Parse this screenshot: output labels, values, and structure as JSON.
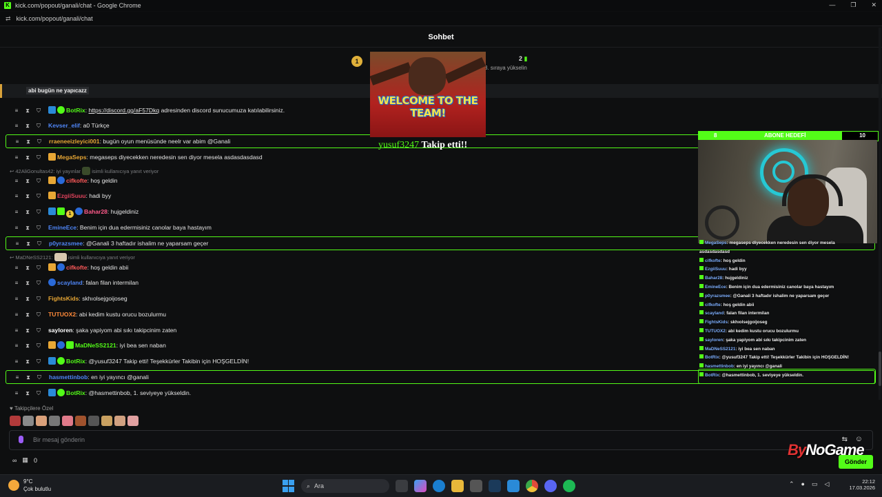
{
  "window": {
    "title": "kick.com/popout/ganali/chat - Google Chrome",
    "url": "kick.com/popout/ganali/chat",
    "min": "—",
    "restore": "❐",
    "close": "✕",
    "tune": "⇄"
  },
  "header": {
    "title": "Sohbet"
  },
  "leaderboard": {
    "rank": "1",
    "count": "2",
    "hint": "3. sıraya yükselin"
  },
  "pinned": {
    "text": "abi bugün ne yapıcazz"
  },
  "tool_icons": {
    "pin": "≡",
    "timeout": "⧗",
    "ban": "⛉"
  },
  "messages": [
    {
      "user": "BotRix",
      "color": "#53fc18",
      "sep": ": ",
      "link": "https://discord.gg/aF57Dkq",
      "text": " adresinden discord sunucumuza katılabilirsiniz."
    },
    {
      "user": "Kevser_elif",
      "color": "#4f86f7",
      "sep": ": ",
      "text": "a0 Türkçe"
    },
    {
      "user": "rraeneeizleyici001",
      "color": "#e8a735",
      "sep": ": ",
      "text": "bugün oyun menüsünde neelr var abim @Ganali"
    },
    {
      "user": "MegaSeps",
      "color": "#e8a735",
      "sep": ": ",
      "text": "megaseps diyecekken neredesin sen diyor mesela asdasdasdasd"
    },
    {
      "user": "cifkofte",
      "color": "#ff5a5a",
      "sep": ": ",
      "text": "hoş geldin"
    },
    {
      "user": "EzgiiSuuu",
      "color": "#e0435c",
      "sep": ": ",
      "text": "hadi byy"
    },
    {
      "user": "Bahar28",
      "color": "#ff5a8a",
      "sep": ": ",
      "text": "hujgeldiniz"
    },
    {
      "user": "EmineEce",
      "color": "#4f86f7",
      "sep": ": ",
      "text": "Benim için dua edermisiniz canolar baya hastayım"
    },
    {
      "user": "p0yrazsmee",
      "color": "#4f86f7",
      "sep": ": ",
      "text": "@Ganali 3 haftadır ishalim ne yaparsam geçer"
    },
    {
      "user": "cifkofte",
      "color": "#ff5a5a",
      "sep": ": ",
      "text": "hoş geldin abii"
    },
    {
      "user": "scayland",
      "color": "#4f86f7",
      "sep": ": ",
      "text": "falan filan intermilan"
    },
    {
      "user": "FightsKids",
      "color": "#e8a735",
      "sep": ": ",
      "text": "skhıolsejgoijoseg"
    },
    {
      "user": "TUTUOX2",
      "color": "#ff8a3a",
      "sep": ": ",
      "text": "abi kedim kustu orucu bozulurmu"
    },
    {
      "user": "sayloren",
      "color": "#ffffff",
      "sep": ": ",
      "text": "şaka yapiyom abi sıkı takipcinim zaten"
    },
    {
      "user": "MaDNeSS2121",
      "color": "#53fc18",
      "sep": ": ",
      "text": "iyi bea sen naban"
    },
    {
      "user": "BotRix",
      "color": "#53fc18",
      "sep": ": ",
      "text": "@yusuf3247 Takip etti! Teşekkürler Takibin için HOŞGELDİN!"
    },
    {
      "user": "hasmettinbob",
      "color": "#4f86f7",
      "sep": ": ",
      "text": "en iyi yayıncı @ganali"
    },
    {
      "user": "BotRix",
      "color": "#53fc18",
      "sep": ": ",
      "text": "@hasmettinbob, 1. seviyeye yükseldin."
    }
  ],
  "replies": [
    {
      "user": "42AliGonultas42",
      "sep": ": ",
      "text": "iyi yayınlar",
      "note": "isimli kullanıcıya yanıt veriyor"
    },
    {
      "user": "MaDNeSS2121",
      "sep": ":",
      "text": "",
      "note": "isimli kullanıcıya yanıt veriyor"
    }
  ],
  "alert": {
    "gif_text": "WELCOME TO THE TEAM!",
    "follower": "yusuf3247",
    "action": " Takip etti!!"
  },
  "goal": {
    "left": "8",
    "label": "ABONE HEDEFİ",
    "right": "10",
    "progress": 0.8
  },
  "overlay": [
    {
      "user": "MegaSeps",
      "text": "megaseps diyecekken neredesin sen diyor mesela"
    },
    {
      "user": "",
      "text": "asdasdasdasd"
    },
    {
      "user": "cifkofte",
      "text": "hoş geldin"
    },
    {
      "user": "EzgiiSuuu",
      "text": "hadi byy"
    },
    {
      "user": "Bahar28",
      "text": "hujgeldiniz"
    },
    {
      "user": "EmineEce",
      "text": "Benim için dua edermisiniz canolar baya hastayım"
    },
    {
      "user": "p0yrazsmee",
      "text": "@Ganali 3 haftadır ishalim ne yaparsam geçer"
    },
    {
      "user": "cifkofte",
      "text": "hoş geldin abii"
    },
    {
      "user": "scayland",
      "text": "falan filan intermilan"
    },
    {
      "user": "FightsKids",
      "text": "skhıolsejgoijoseg"
    },
    {
      "user": "TUTUOX2",
      "text": "abi kedim kustu orucu bozulurmu"
    },
    {
      "user": "sayloren",
      "text": "şaka yapiyom abi sıkı takipcinim zaten"
    },
    {
      "user": "MaDNeSS2121",
      "text": "iyi bea sen naban"
    },
    {
      "user": "BotRix",
      "text": "@yusuf3247 Takip etti! Teşekkürler Takibin için HOŞGELDİN!"
    },
    {
      "user": "hasmettinbob",
      "text": "en iyi yayıncı @ganali"
    },
    {
      "user": "BotRix",
      "text": "@hasmettinbob, 1. seviyeye yükseldin."
    }
  ],
  "ov_sep": ": ",
  "followers_only": {
    "heart": "♥",
    "label": "Takipçilere Özel"
  },
  "input": {
    "placeholder": "Bir mesaj gönderin",
    "translate": "⇆",
    "emoji": "☺"
  },
  "bottom": {
    "points_icon": "∞",
    "gift_icon": "▦",
    "gift_count": "0",
    "send": "Gönder"
  },
  "brand": {
    "by": "By",
    "name": "NoGame"
  },
  "taskbar": {
    "temp": "9°C",
    "weather": "Çok bulutlu",
    "search": "Ara",
    "search_icon": "⌕",
    "tray_up": "⌃",
    "time": "22:12",
    "date": "17.03.2026"
  }
}
